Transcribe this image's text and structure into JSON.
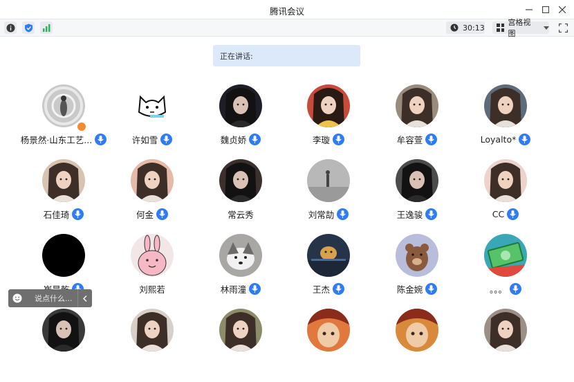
{
  "window": {
    "title": "腾讯会议"
  },
  "toolbar": {
    "timer": "30:13",
    "view_label": "宫格视图"
  },
  "speaking_label": "正在讲话:",
  "chat": {
    "placeholder": "说点什么..."
  },
  "participants": [
    {
      "name": "杨景然·山东工艺...",
      "mic": true,
      "host": true,
      "color": "#c9c9c9",
      "icon": "record-disc"
    },
    {
      "name": "许如雪",
      "mic": true,
      "color": "#ffffff",
      "icon": "cat-sketch"
    },
    {
      "name": "魏贞娇",
      "mic": true,
      "color": "#1e1e28",
      "icon": "portrait-dark"
    },
    {
      "name": "李璇",
      "mic": true,
      "color": "#c84a3a",
      "icon": "portrait-red"
    },
    {
      "name": "牟容萱",
      "mic": true,
      "color": "#9a8c7c",
      "icon": "portrait"
    },
    {
      "name": "Loyalto*",
      "mic": true,
      "color": "#5e6b7a",
      "icon": "portrait"
    },
    {
      "name": "石佳琦",
      "mic": true,
      "color": "#d8c2b2",
      "icon": "portrait"
    },
    {
      "name": "何金",
      "mic": true,
      "color": "#e6b9a9",
      "icon": "portrait"
    },
    {
      "name": "常云秀",
      "mic": false,
      "color": "#3b302c",
      "icon": "portrait-dark"
    },
    {
      "name": "刘常劼",
      "mic": true,
      "color": "#b8b8b8",
      "icon": "landscape-grey"
    },
    {
      "name": "王逸骏",
      "mic": true,
      "color": "#4c4c4c",
      "icon": "portrait-dark"
    },
    {
      "name": "CC",
      "mic": true,
      "color": "#ecd3cb",
      "icon": "portrait"
    },
    {
      "name": "崔昊乾",
      "mic": true,
      "color": "#000000",
      "icon": "blank"
    },
    {
      "name": "刘熙若",
      "mic": false,
      "color": "#f2e6e6",
      "icon": "rabbit-sketch"
    },
    {
      "name": "林雨潼",
      "mic": true,
      "color": "#a9a7a4",
      "icon": "dog"
    },
    {
      "name": "王杰",
      "mic": true,
      "color": "#26344a",
      "icon": "dog-car"
    },
    {
      "name": "陈金婉",
      "mic": true,
      "color": "#b9bddc",
      "icon": "bear"
    },
    {
      "name": "。。。",
      "mic": true,
      "color": "#3aa7b6",
      "icon": "money"
    },
    {
      "name": "",
      "mic": false,
      "color": "#3a3a3a",
      "icon": "portrait-dark"
    },
    {
      "name": "",
      "mic": false,
      "color": "#d7cfc8",
      "icon": "portrait"
    },
    {
      "name": "",
      "mic": false,
      "color": "#8c8c6a",
      "icon": "portrait"
    },
    {
      "name": "",
      "mic": false,
      "color": "#e1793e",
      "icon": "anime"
    },
    {
      "name": "",
      "mic": false,
      "color": "#d88a3a",
      "icon": "anime"
    },
    {
      "name": "",
      "mic": false,
      "color": "#9c8f86",
      "icon": "portrait"
    }
  ]
}
